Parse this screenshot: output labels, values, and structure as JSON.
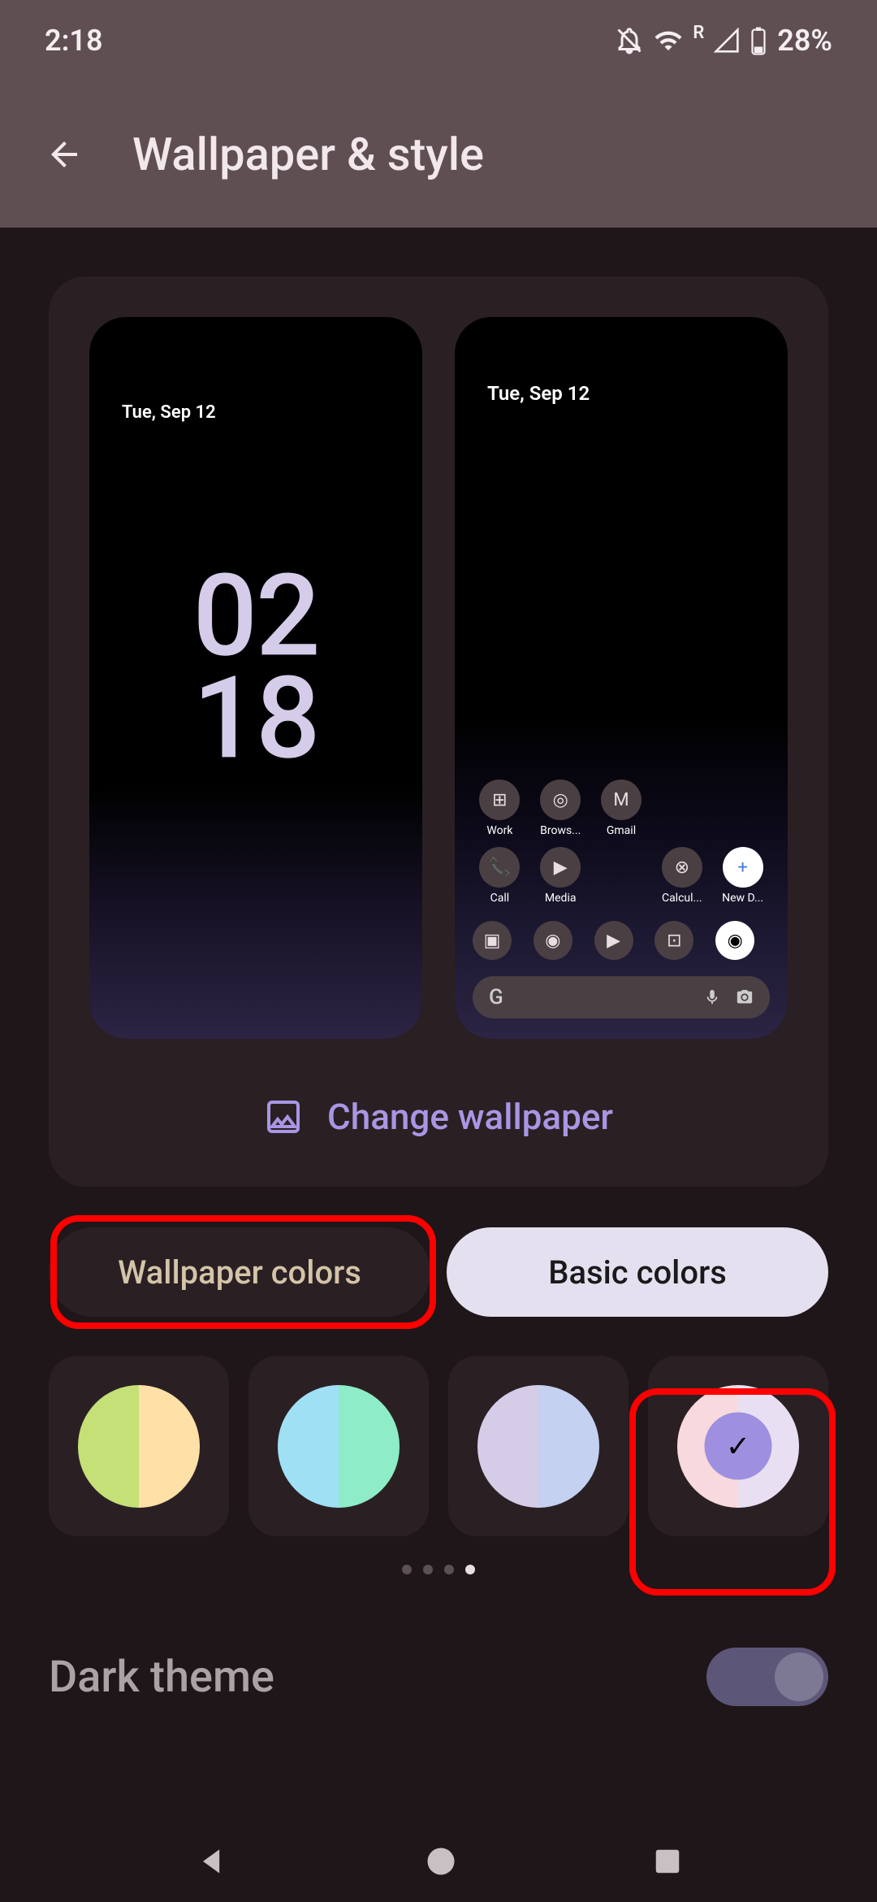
{
  "status": {
    "time": "2:18",
    "roaming": "R",
    "battery": "28%"
  },
  "header": {
    "title": "Wallpaper & style"
  },
  "preview": {
    "lock_date": "Tue, Sep 12",
    "lock_time_top": "02",
    "lock_time_bottom": "18",
    "home_date": "Tue, Sep 12",
    "apps": [
      {
        "label": "Work"
      },
      {
        "label": "Brows..."
      },
      {
        "label": "Gmail"
      },
      {
        "label": ""
      },
      {
        "label": ""
      },
      {
        "label": "Call"
      },
      {
        "label": "Media"
      },
      {
        "label": ""
      },
      {
        "label": "Calcul..."
      },
      {
        "label": "New D..."
      }
    ],
    "change_wallpaper": "Change wallpaper"
  },
  "tabs": {
    "wallpaper_colors": "Wallpaper colors",
    "basic_colors": "Basic colors"
  },
  "swatches": [
    {
      "left": "#c4e076",
      "right": "#ffe0a6",
      "selected": false
    },
    {
      "left": "#9fe0f5",
      "right": "#8eecc6",
      "selected": false
    },
    {
      "left": "#d5cce8",
      "right": "#c4d1f0",
      "selected": false
    },
    {
      "left": "#f8d9dd",
      "right": "#e8e0f2",
      "center": "#9e8fe0",
      "selected": true
    }
  ],
  "dark_theme": {
    "label": "Dark theme",
    "enabled": true
  }
}
